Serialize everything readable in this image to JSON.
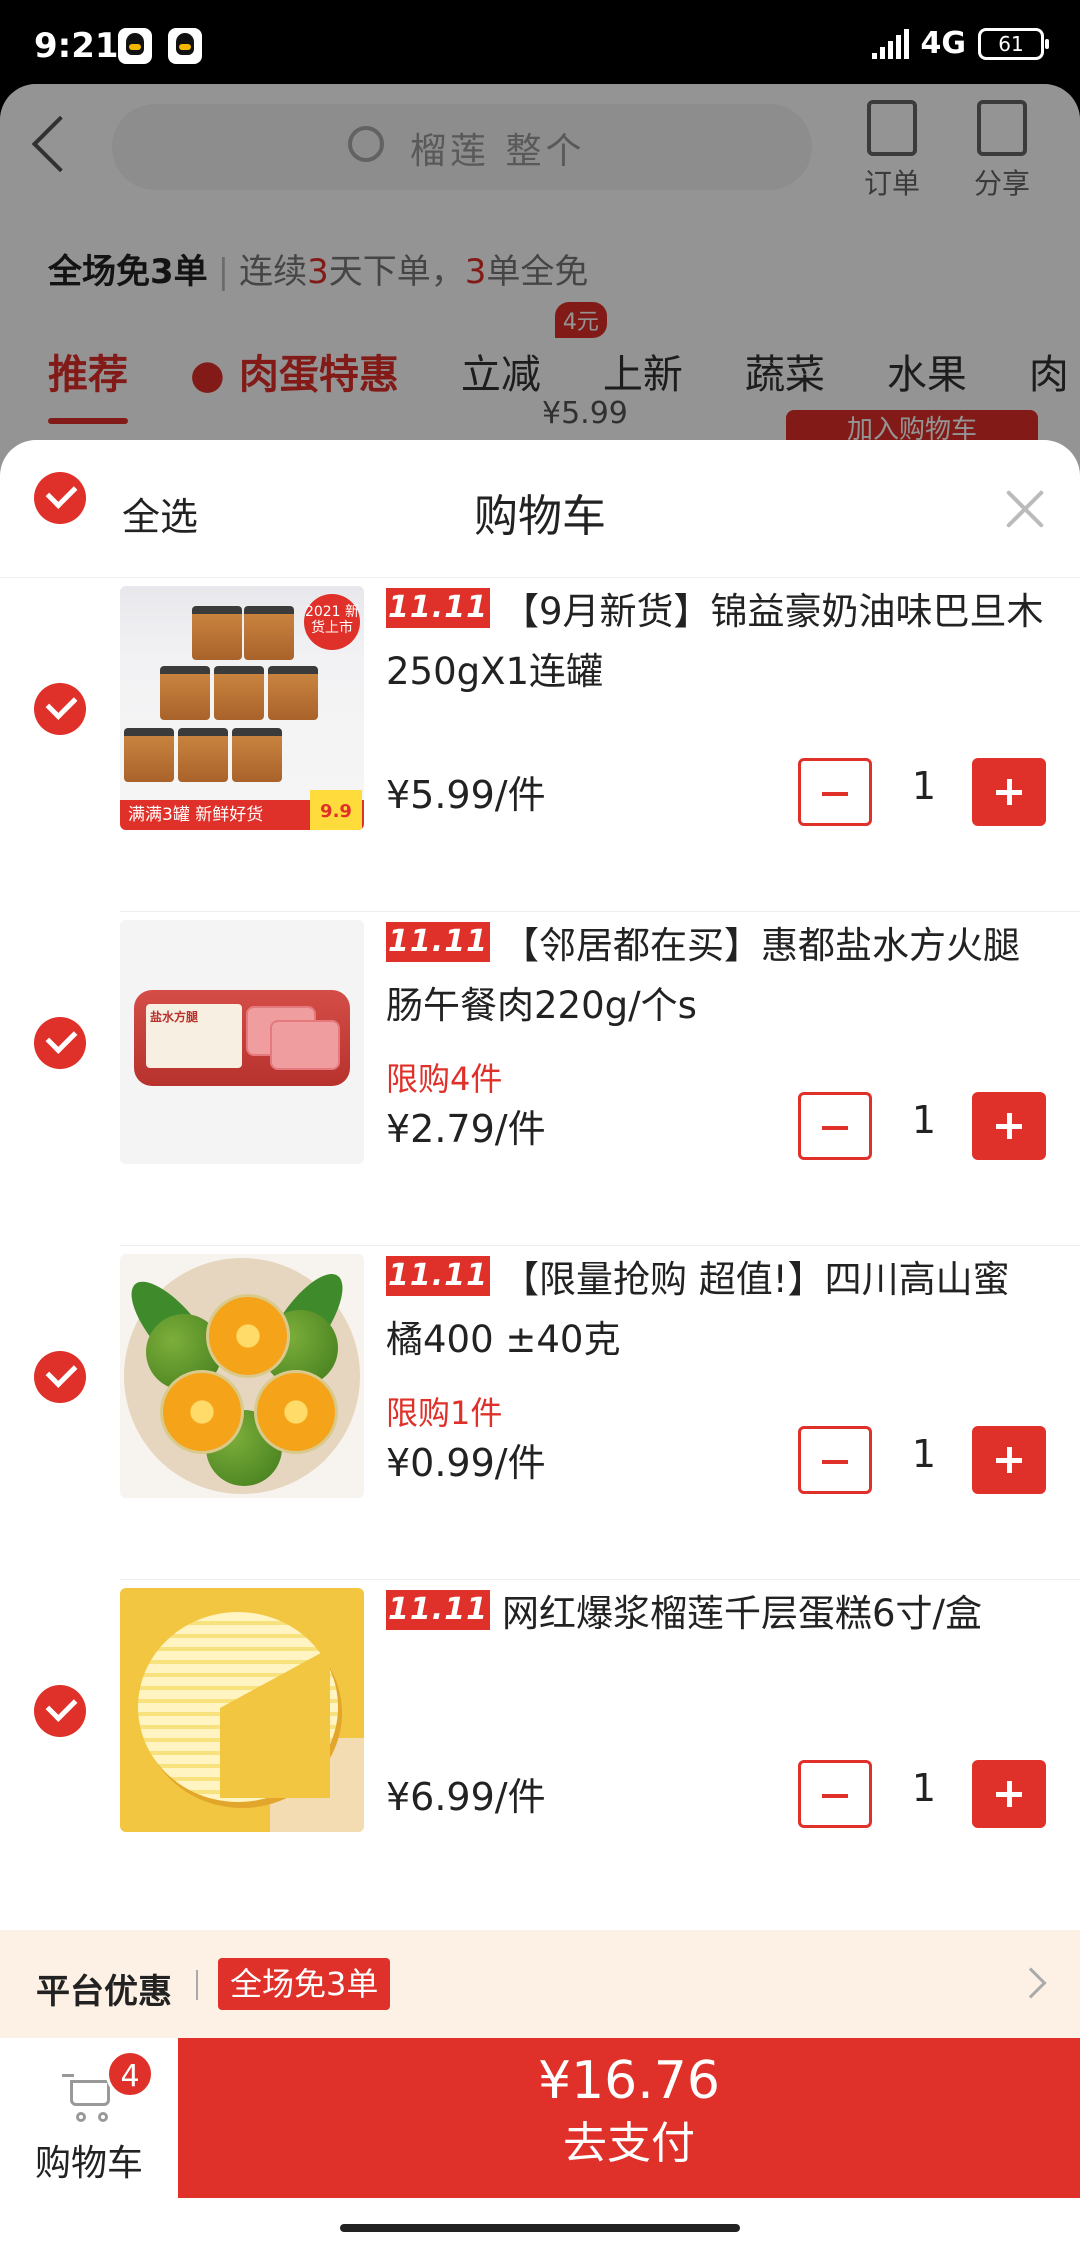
{
  "status_bar": {
    "time": "9:21",
    "network": "4G",
    "battery": "61"
  },
  "background_page": {
    "search_placeholder": "榴莲 整个",
    "orders_label": "订单",
    "share_label": "分享",
    "promo_title": "全场免3单",
    "promo_desc_prefix": "连续",
    "promo_desc_num1": "3",
    "promo_desc_mid": "天下单，",
    "promo_desc_num2": "3",
    "promo_desc_suffix": "单全免",
    "tabs": [
      "推荐",
      "肉蛋特惠",
      "立减",
      "上新",
      "蔬菜",
      "水果",
      "肉"
    ],
    "tab_badge": "4元",
    "behind_price": "¥5.99",
    "behind_button": "加入购物车"
  },
  "cart": {
    "select_all_label": "全选",
    "title": "购物车",
    "event_tag": "11.11",
    "items": [
      {
        "title": "【9月新货】锦益豪奶油味巴旦木250gX1连罐",
        "limit": "",
        "price": "¥5.99/件",
        "qty": "1",
        "image_badge": "2021 新货上市",
        "image_strip": "满满3罐  新鲜好货",
        "image_price": "9.9"
      },
      {
        "title": "【邻居都在买】惠都盐水方火腿肠午餐肉220g/个s",
        "limit": "限购4件",
        "price": "¥2.79/件",
        "qty": "1",
        "image_label": "盐水方腿"
      },
      {
        "title": "【限量抢购 超值!】四川高山蜜橘400 ±40克",
        "limit": "限购1件",
        "price": "¥0.99/件",
        "qty": "1"
      },
      {
        "title": "网红爆浆榴莲千层蛋糕6寸/盒",
        "limit": "",
        "price": "¥6.99/件",
        "qty": "1"
      }
    ],
    "platform_discount_label": "平台优惠",
    "platform_discount_tag": "全场免3单",
    "cart_label": "购物车",
    "cart_count": "4",
    "total": "¥16.76",
    "pay_label": "去支付"
  },
  "colors": {
    "accent": "#e0302a",
    "promo_bg": "#fdf1e5"
  }
}
